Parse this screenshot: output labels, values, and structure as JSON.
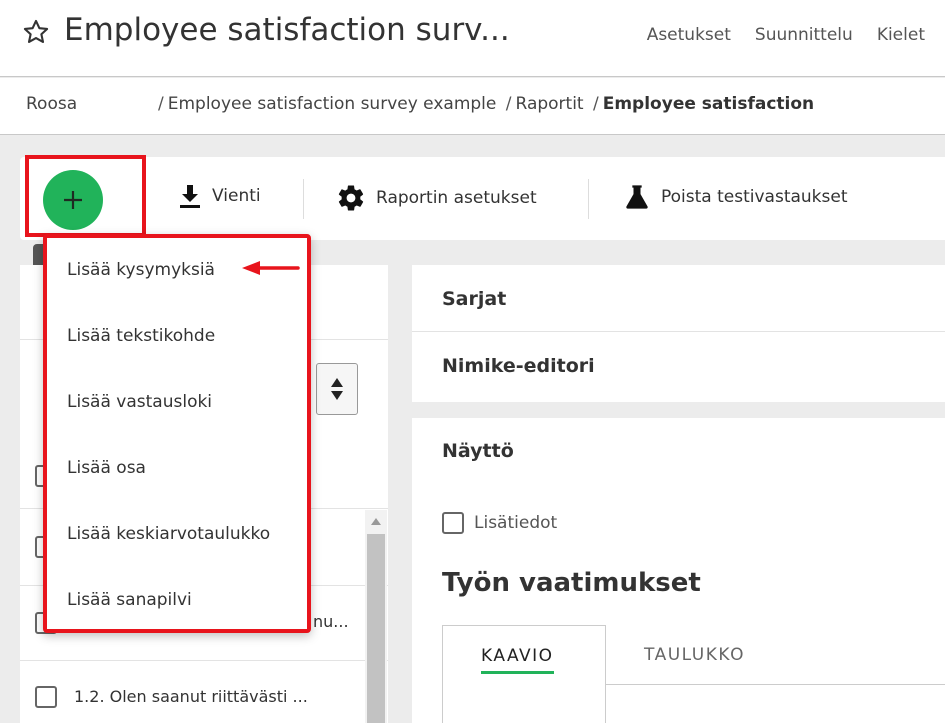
{
  "header": {
    "title": "Employee satisfaction surv...",
    "nav": [
      "Asetukset",
      "Suunnittelu",
      "Kielet"
    ]
  },
  "breadcrumb": {
    "user": "Roosa",
    "path": [
      "Employee satisfaction survey example",
      "Raportit"
    ],
    "current": "Employee satisfaction"
  },
  "toolbar": {
    "export_label": "Vienti",
    "report_settings_label": "Raportin asetukset",
    "delete_test_label": "Poista testivastaukset"
  },
  "dropdown": {
    "items": [
      "Lisää kysymyksiä",
      "Lisää tekstikohde",
      "Lisää vastausloki",
      "Lisää osa",
      "Lisää keskiarvotaulukko",
      "Lisää sanapilvi"
    ]
  },
  "left_panel": {
    "row_partial": "nu...",
    "row_question": "1.2.  Olen saanut riittävästi ..."
  },
  "right_panel": {
    "sections": [
      "Sarjat",
      "Nimike-editori"
    ],
    "display_label": "Näyttö",
    "details_label": "Lisätiedot",
    "section_title": "Työn vaatimukset",
    "tabs": [
      "KAAVIO",
      "TAULUKKO"
    ]
  },
  "colors": {
    "accent_green": "#21b35a",
    "highlight_red": "#e8141c"
  }
}
